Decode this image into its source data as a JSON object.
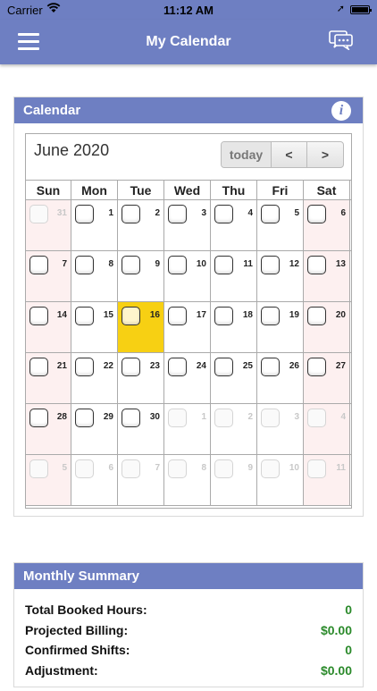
{
  "status_bar": {
    "carrier": "Carrier",
    "time": "11:12 AM"
  },
  "nav": {
    "title": "My Calendar"
  },
  "calendar": {
    "panel_title": "Calendar",
    "month_title": "June 2020",
    "today_label": "today",
    "prev_label": "<",
    "next_label": ">",
    "day_names": [
      "Sun",
      "Mon",
      "Tue",
      "Wed",
      "Thu",
      "Fri",
      "Sat"
    ],
    "weeks": [
      [
        {
          "d": "31",
          "other": true
        },
        {
          "d": "1"
        },
        {
          "d": "2"
        },
        {
          "d": "3"
        },
        {
          "d": "4"
        },
        {
          "d": "5"
        },
        {
          "d": "6"
        }
      ],
      [
        {
          "d": "7"
        },
        {
          "d": "8"
        },
        {
          "d": "9"
        },
        {
          "d": "10"
        },
        {
          "d": "11"
        },
        {
          "d": "12"
        },
        {
          "d": "13"
        }
      ],
      [
        {
          "d": "14"
        },
        {
          "d": "15"
        },
        {
          "d": "16",
          "today": true
        },
        {
          "d": "17"
        },
        {
          "d": "18"
        },
        {
          "d": "19"
        },
        {
          "d": "20"
        }
      ],
      [
        {
          "d": "21"
        },
        {
          "d": "22"
        },
        {
          "d": "23"
        },
        {
          "d": "24"
        },
        {
          "d": "25"
        },
        {
          "d": "26"
        },
        {
          "d": "27"
        }
      ],
      [
        {
          "d": "28"
        },
        {
          "d": "29"
        },
        {
          "d": "30"
        },
        {
          "d": "1",
          "other": true
        },
        {
          "d": "2",
          "other": true
        },
        {
          "d": "3",
          "other": true
        },
        {
          "d": "4",
          "other": true
        }
      ],
      [
        {
          "d": "5",
          "other": true
        },
        {
          "d": "6",
          "other": true
        },
        {
          "d": "7",
          "other": true
        },
        {
          "d": "8",
          "other": true
        },
        {
          "d": "9",
          "other": true
        },
        {
          "d": "10",
          "other": true
        },
        {
          "d": "11",
          "other": true
        }
      ]
    ]
  },
  "summary": {
    "panel_title": "Monthly Summary",
    "rows": [
      {
        "label": "Total Booked Hours:",
        "value": "0"
      },
      {
        "label": "Projected Billing:",
        "value": "$0.00"
      },
      {
        "label": "Confirmed Shifts:",
        "value": "0"
      },
      {
        "label": "Adjustment:",
        "value": "$0.00"
      }
    ]
  },
  "colors": {
    "header": "#6e7fc2",
    "today": "#f7d013",
    "weekend": "#fdf0f0",
    "value_green": "#2b8a2b"
  }
}
